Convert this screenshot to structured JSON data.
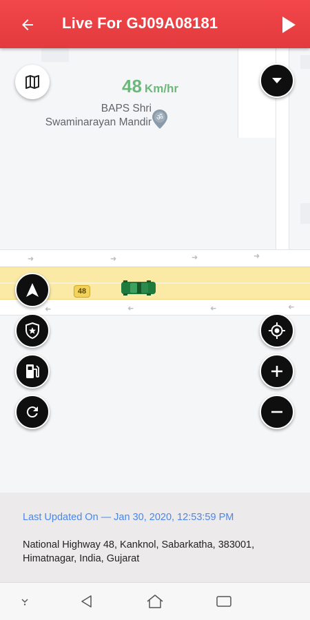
{
  "header": {
    "title": "Live For GJ09A08181"
  },
  "map": {
    "speed_value": "48",
    "speed_unit": "Km/hr",
    "poi_line1": "BAPS Shri",
    "poi_line2": "Swaminarayan Mandir",
    "highway_shield": "48"
  },
  "info": {
    "last_updated": "Last Updated On — Jan 30, 2020, 12:53:59 PM",
    "address": "National Highway 48, Kanknol, Sabarkatha, 383001, Himatnagar, India, Gujarat"
  },
  "colors": {
    "header": "#e23a3e",
    "speed": "#6cb87a",
    "updated_text": "#4a86e8",
    "fab": "#0f0f0f",
    "road": "#fbe9a6"
  },
  "icons": {
    "back": "arrow-left-icon",
    "play": "play-icon",
    "map_type": "map-icon",
    "dropdown": "chevron-down-icon",
    "navigate": "navigation-arrow-icon",
    "police": "police-badge-icon",
    "fuel": "fuel-pump-icon",
    "refresh": "refresh-icon",
    "locate": "my-location-icon",
    "zoom_in": "plus-icon",
    "zoom_out": "minus-icon",
    "poi": "om-place-icon",
    "car": "car-icon"
  }
}
